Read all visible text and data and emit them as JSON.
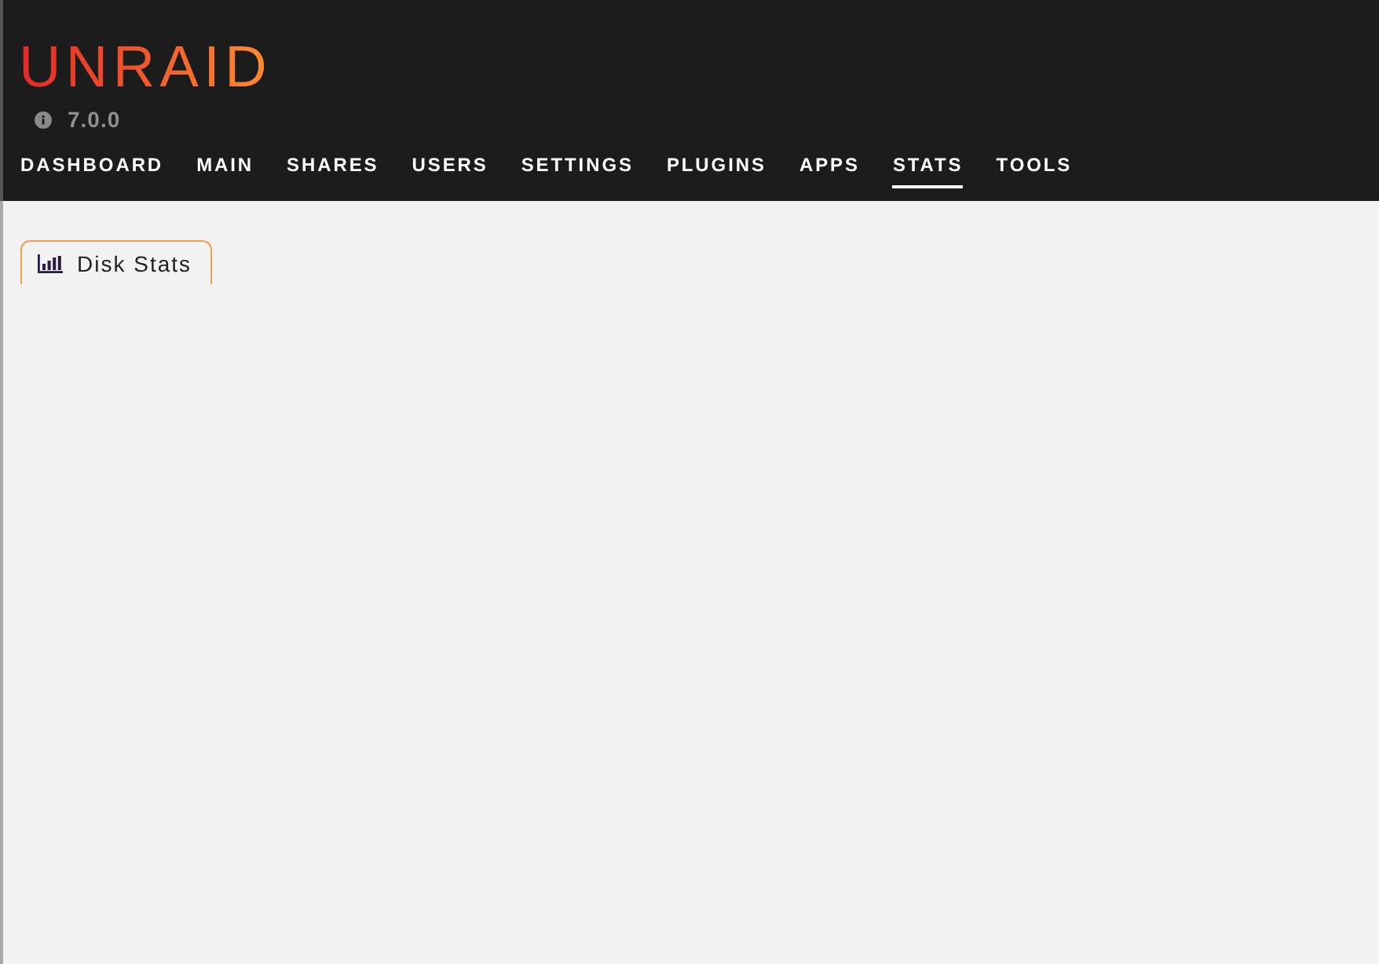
{
  "logo": {
    "text": "UNRAID"
  },
  "version": {
    "text": "7.0.0"
  },
  "nav": [
    {
      "label": "DASHBOARD",
      "selected": false
    },
    {
      "label": "MAIN",
      "selected": false
    },
    {
      "label": "SHARES",
      "selected": false
    },
    {
      "label": "USERS",
      "selected": false
    },
    {
      "label": "SETTINGS",
      "selected": false
    },
    {
      "label": "PLUGINS",
      "selected": false
    },
    {
      "label": "APPS",
      "selected": false
    },
    {
      "label": "STATS",
      "selected": true
    },
    {
      "label": "TOOLS",
      "selected": false
    }
  ],
  "tabs": [
    {
      "label": "Disk Stats",
      "selected": true
    }
  ]
}
